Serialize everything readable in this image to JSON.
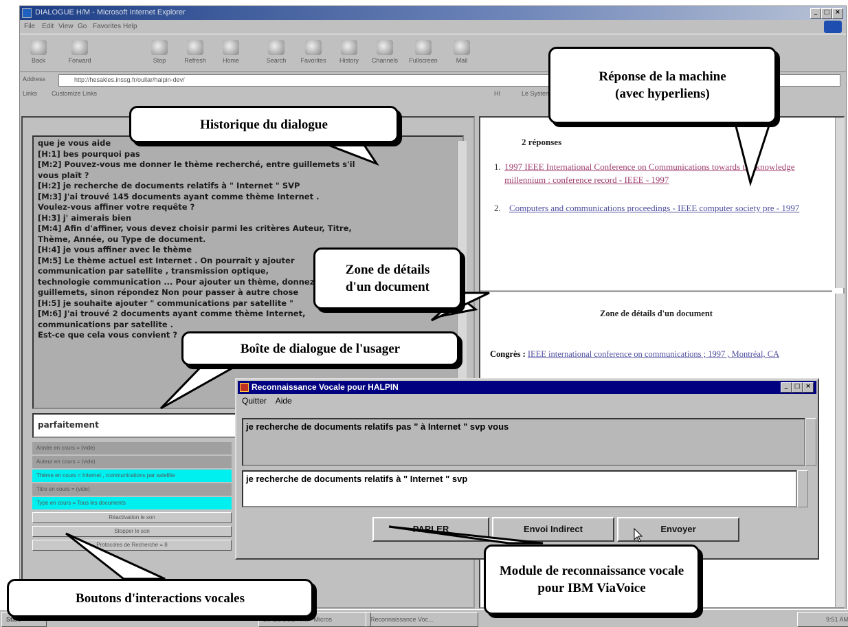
{
  "browser": {
    "title": "DIALOGUE H/M - Microsoft Internet Explorer",
    "menu": [
      "File",
      "Edit",
      "View",
      "Go",
      "Favorites",
      "Help"
    ],
    "toolbar": [
      "Back",
      "Forward",
      "Stop",
      "Refresh",
      "Home",
      "Search",
      "Favorites",
      "History",
      "Channels",
      "Fullscreen",
      "Mail"
    ],
    "address_label": "Address",
    "address": "http://hesakles.inssg.fr/oullar/halpin-dev/",
    "links_label": "Links",
    "links": [
      "Customize Links",
      "HI",
      "Le Systeme"
    ]
  },
  "history": {
    "lines": [
      "que je vous aide",
      "[H:1] bes pourquoi pas",
      "[M:2] Pouvez-vous me donner le thème recherché, entre guillemets s'il",
      "vous plaît ?",
      "[H:2]  je recherche de documents relatifs à \" Internet \" SVP",
      "[M:3] J'ai trouvé 145 documents  ayant comme thème  Internet .",
      "Voulez-vous affiner votre requête ?",
      "[H:3]  j' aimerais bien",
      "[M:4] Afin d'affiner, vous devez choisir parmi les critères Auteur, Titre,",
      "Thème, Année, ou Type de document.",
      "[H:4]  je vous affiner avec le thème",
      "[M:5] Le thème actuel est  Internet . On pourrait y ajouter",
      "communication par satellite , transmission optique,",
      "technologie communication ... Pour ajouter un thème, donnez le entre",
      "guillemets, sinon répondez Non pour passer à autre chose",
      "[H:5] je souhaite ajouter \" communications par satellite \"",
      "[M:6] J'ai trouvé 2 documents ayant comme thème Internet,",
      "communications par satellite .",
      "Est-ce que cela vous convient ?"
    ]
  },
  "user_input": "parfaitement",
  "criteria": [
    {
      "text": "Année en cours = (vide)",
      "highlight": false
    },
    {
      "text": "Auteur en cours = (vide)",
      "highlight": false
    },
    {
      "text": "Thème en cours =  Internet , communications par satellite",
      "highlight": true
    },
    {
      "text": "Titre en cours = (vide)",
      "highlight": false
    },
    {
      "text": "Type en cours = Tous les documents",
      "highlight": true
    }
  ],
  "vocal_buttons": [
    "Réactivation le son",
    "Stopper le son",
    "Protocoles de Recherche = 8"
  ],
  "response": {
    "heading": "2 réponses",
    "items": [
      {
        "num": "1.",
        "text": "1997 IEEE International Conference on Communications towards the knowledge millennium : conference record - IEEE - 1997"
      },
      {
        "num": "2.",
        "text": "Computers and communications proceedings - IEEE computer society pre - 1997"
      }
    ]
  },
  "details": {
    "heading": "Zone de détails d'un document",
    "label": "Congrès : ",
    "value": "IEEE international conference on communications ; 1997 , Montréal, CA"
  },
  "voice_dialog": {
    "title": "Reconnaissance Vocale pour HALPIN",
    "menu": [
      "Quitter",
      "Aide"
    ],
    "recognized": "je recherche de documents relatifs pas \" à Internet \" svp vous",
    "confirmed": "je recherche de documents relatifs à \" Internet \" svp",
    "buttons": [
      "PARLER",
      "Envoi Indirect",
      "Envoyer"
    ]
  },
  "taskbar": {
    "start": "Start",
    "items": [
      "DIALOGUE H/M - Micros",
      "Reconnaissance Voc..."
    ],
    "clock": "9:51 AM"
  },
  "callouts": {
    "reponse": [
      "Réponse de la machine",
      "(avec hyperliens)"
    ],
    "historique": "Historique du dialogue",
    "zone": [
      "Zone de détails",
      "d'un document"
    ],
    "boite": "Boîte de dialogue de l'usager",
    "module": [
      "Module de reconnaissance vocale",
      "pour IBM ViaVoice"
    ],
    "boutons": "Boutons d'interactions vocales"
  }
}
